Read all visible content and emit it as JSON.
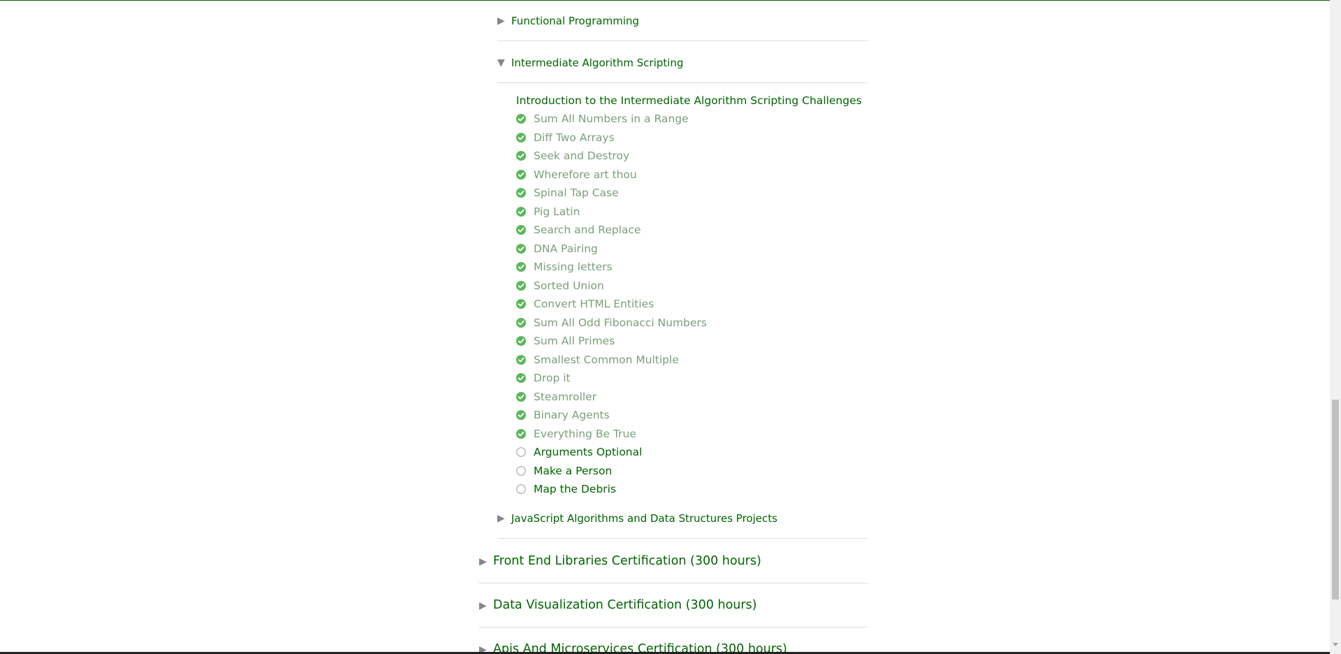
{
  "sections": {
    "functional_programming": {
      "label": "Functional Programming",
      "arrow": "▶"
    },
    "intermediate_algorithm": {
      "label": "Intermediate Algorithm Scripting",
      "arrow": "▼"
    },
    "intro_link": "Introduction to the Intermediate Algorithm Scripting Challenges",
    "projects": {
      "label": "JavaScript Algorithms and Data Structures Projects",
      "arrow": "▶"
    }
  },
  "challenges": [
    {
      "title": "Sum All Numbers in a Range",
      "completed": true
    },
    {
      "title": "Diff Two Arrays",
      "completed": true
    },
    {
      "title": "Seek and Destroy",
      "completed": true
    },
    {
      "title": "Wherefore art thou",
      "completed": true
    },
    {
      "title": "Spinal Tap Case",
      "completed": true
    },
    {
      "title": "Pig Latin",
      "completed": true
    },
    {
      "title": "Search and Replace",
      "completed": true
    },
    {
      "title": "DNA Pairing",
      "completed": true
    },
    {
      "title": "Missing letters",
      "completed": true
    },
    {
      "title": "Sorted Union",
      "completed": true
    },
    {
      "title": "Convert HTML Entities",
      "completed": true
    },
    {
      "title": "Sum All Odd Fibonacci Numbers",
      "completed": true
    },
    {
      "title": "Sum All Primes",
      "completed": true
    },
    {
      "title": "Smallest Common Multiple",
      "completed": true
    },
    {
      "title": "Drop it",
      "completed": true
    },
    {
      "title": "Steamroller",
      "completed": true
    },
    {
      "title": "Binary Agents",
      "completed": true
    },
    {
      "title": "Everything Be True",
      "completed": true
    },
    {
      "title": "Arguments Optional",
      "completed": false
    },
    {
      "title": "Make a Person",
      "completed": false
    },
    {
      "title": "Map the Debris",
      "completed": false
    }
  ],
  "certifications": [
    {
      "label": "Front End Libraries Certification (300 hours)",
      "arrow": "▶"
    },
    {
      "label": "Data Visualization Certification (300 hours)",
      "arrow": "▶"
    },
    {
      "label": "Apis And Microservices Certification (300 hours)",
      "arrow": "▶"
    }
  ],
  "colors": {
    "accent": "#006400",
    "completed_text": "#7a9f7a",
    "check_fill": "#5cb85c",
    "divider": "#dddddd"
  },
  "icons": {
    "completed": "check-circle-icon",
    "incomplete": "empty-circle-icon",
    "collapsed": "caret-right-icon",
    "expanded": "caret-down-icon"
  }
}
